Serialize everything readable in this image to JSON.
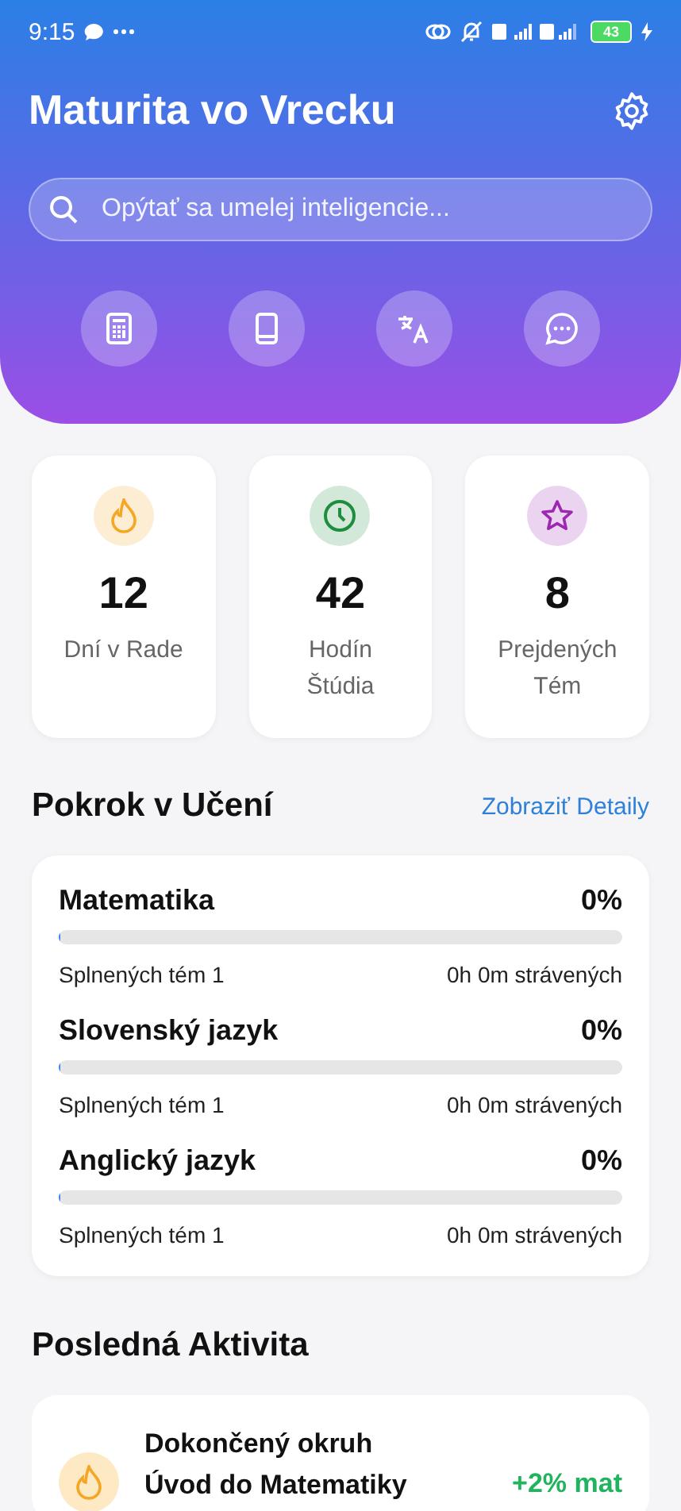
{
  "status_bar": {
    "time": "9:15",
    "battery": "43"
  },
  "header": {
    "title": "Maturita vo Vrecku",
    "search": {
      "placeholder": "Opýtať sa umelej inteligencie..."
    },
    "quick_actions": [
      {
        "kind": "calculator"
      },
      {
        "kind": "book"
      },
      {
        "kind": "translate"
      },
      {
        "kind": "chat"
      }
    ]
  },
  "stats": [
    {
      "kind": "flame",
      "value": "12",
      "label": "Dní v Rade",
      "color": "#f5a623"
    },
    {
      "kind": "clock",
      "value": "42",
      "label": "Hodín Štúdia",
      "color": "#1e8e3e"
    },
    {
      "kind": "star",
      "value": "8",
      "label": "Prejdených Tém",
      "color": "#9c27b0"
    }
  ],
  "progress": {
    "title": "Pokrok v Učení",
    "link": "Zobraziť Detaily",
    "subjects": [
      {
        "name": "Matematika",
        "percent": "0%",
        "level": 0,
        "topics": "Splnených tém 1",
        "time": "0h 0m strávených"
      },
      {
        "name": "Slovenský jazyk",
        "percent": "0%",
        "level": 0,
        "topics": "Splnených tém 1",
        "time": "0h 0m strávených"
      },
      {
        "name": "Anglický jazyk",
        "percent": "0%",
        "level": 0,
        "topics": "Splnených tém 1",
        "time": "0h 0m strávených"
      }
    ]
  },
  "activity": {
    "title": "Posledná Aktivita",
    "items": [
      {
        "kind": "flame",
        "title": "Dokončený okruh",
        "subtitle": "Úvod do Matematiky",
        "gain": "+2% mat"
      }
    ]
  }
}
